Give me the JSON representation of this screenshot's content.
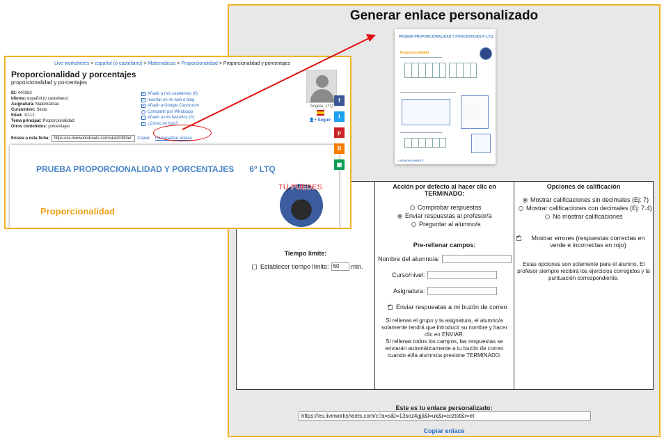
{
  "main": {
    "title": "Generar enlace personalizado",
    "thumbnail": {
      "title": "PRUEBA PROPORCIONALIDAD Y PORCENTAJES    6º LTQ",
      "subtitle": "Proporcionalidad",
      "footer": "LIVEWORKSHEETS"
    },
    "time_limit": {
      "heading": "Tiempo límite:",
      "checkbox_label": "Establecer tiempo límite:",
      "value": "60",
      "unit": "min."
    },
    "finish_action": {
      "heading": "Acción por defecto al hacer clic en TERMINADO:",
      "options": [
        "Comprobar respuestas",
        "Enviar respuestas al profesor/a",
        "Preguntar al alumno/a"
      ],
      "selected_index": 1
    },
    "prefill": {
      "heading": "Pre-rellenar campos:",
      "name_label": "Nombre del alumno/a:",
      "course_label": "Curso/nivel:",
      "subject_label": "Asignatura:",
      "send_label": "Enviar respueatas a mi buzón de correo",
      "note": "Si rellenas el grupo y la asignatura, el alumno/a solamente tendrá que introducir su nombre y hacer clic en ENVIAR.\nSi rellenas todos los campos, las respuestas se enviarán automáticamente a tu buzón de correo cuando el/la alumno/a presione TERMINADO."
    },
    "grading": {
      "heading": "Opciones de calificación",
      "options": [
        "Mostrar calificaciones sin decimales (Ej: 7)",
        "Mostrar calificaciones con decimales (Ej: 7.4)",
        "No mostrar calificaciones"
      ],
      "selected_index": 0,
      "errors_label": "Mostrar errores (respuestas correctas en verde e incorrectas en rojo)",
      "note": "Estas opciones son solamente para el alumno. El profesor siempre recibirá los ejercicios corregidos y la puntuación correspondiente."
    },
    "link": {
      "label": "Este es tu enlace personalizado:",
      "url": "https://es.liveworksheets.com/c?a=s&t=13sez4gjjl&l=uk&i=ccztot&r=et",
      "copy_label": "Copiar enlace"
    }
  },
  "overlay": {
    "breadcrumb": {
      "items": [
        "Live worksheets",
        "español (o castellano)",
        "Matemáticas",
        "Proporcionalidad"
      ],
      "separator": " > ",
      "current": "Proporcionalidad y porcentajes"
    },
    "title": "Proporcionalidad y porcentajes",
    "subtitle": "proporcionalidad y porcentajes",
    "meta": {
      "id_label": "ID:",
      "id": "440383",
      "language_label": "Idioma:",
      "language": "español (o castellano)",
      "subject_label": "Asignatura:",
      "subject": "Matemáticas",
      "level_label": "Curso/nivel:",
      "level": "Sexto",
      "age_label": "Edad:",
      "age": "10-12",
      "topic_label": "Tema principal:",
      "topic": "Proporcionalidad",
      "other_label": "Otros contenidos:",
      "other": "porcentajes"
    },
    "actions": [
      "Añadir a mis cuadernos (0)",
      "Insertar en mi web o blog",
      "Añadir a Google Classroom",
      "Compartir por Whatsapp",
      "Añadir a mis favoritos (0)",
      "¿Cómo se hizo?"
    ],
    "user": {
      "name": "Angela_LTQ",
      "follow": "Seguir"
    },
    "link_row": {
      "label": "Enlaza a esta ficha:",
      "url": "https://es.liveworksheets.com/uk440383et",
      "copy": "Copiar",
      "customize": "Personalizar enlace"
    },
    "preview": {
      "title": "PRUEBA PROPORCIONALIDAD Y PORCENTAJES",
      "grade": "6º LTQ",
      "subtitle": "Proporcionalidad",
      "badge_text": "TÚ PUEDES"
    },
    "share": [
      {
        "icon": "facebook-icon",
        "glyph": "f",
        "color": "#3b5998"
      },
      {
        "icon": "twitter-icon",
        "glyph": "t",
        "color": "#1da1f2"
      },
      {
        "icon": "pinterest-icon",
        "glyph": "p",
        "color": "#cb2027"
      },
      {
        "icon": "blogger-icon",
        "glyph": "B",
        "color": "#f57d00"
      },
      {
        "icon": "classroom-icon",
        "glyph": "▣",
        "color": "#0f9d58"
      }
    ]
  },
  "colors": {
    "frame": "#f3b221",
    "link": "#2a6bc4",
    "title_blue": "#4a86c7",
    "title_orange": "#f0a31a",
    "annotation": "#e01010"
  }
}
